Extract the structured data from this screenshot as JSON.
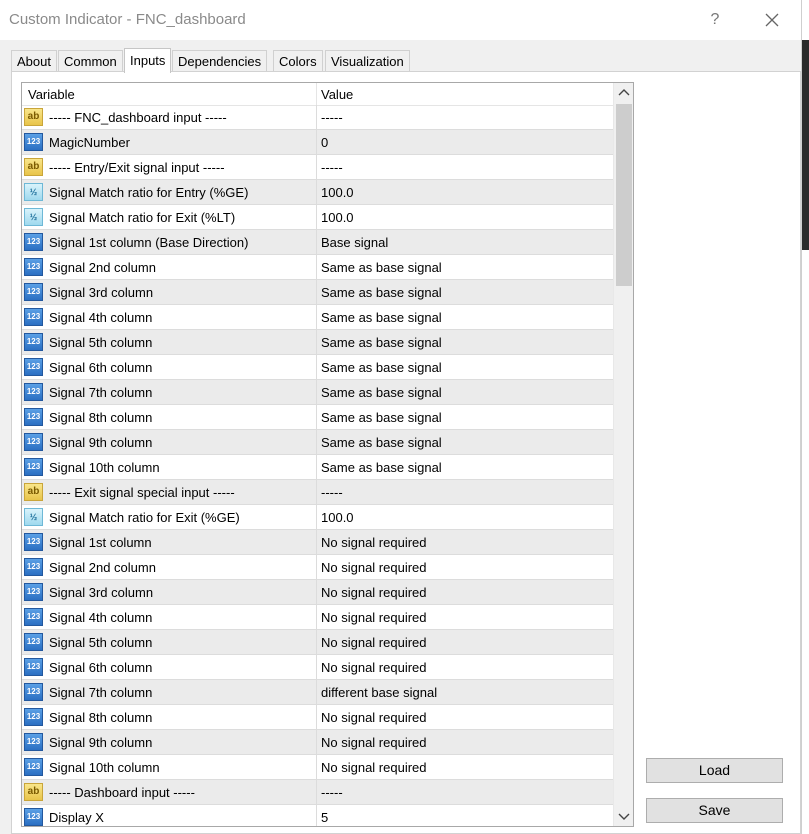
{
  "window": {
    "title": "Custom Indicator - FNC_dashboard",
    "help_label": "?"
  },
  "tabs": [
    {
      "label": "About"
    },
    {
      "label": "Common"
    },
    {
      "label": "Inputs",
      "active": true
    },
    {
      "label": "Dependencies"
    },
    {
      "label": "Colors"
    },
    {
      "label": "Visualization"
    }
  ],
  "grid": {
    "headers": {
      "variable": "Variable",
      "value": "Value"
    },
    "rows": [
      {
        "type": "string",
        "icon": "ab-icon",
        "variable": "----- FNC_dashboard input -----",
        "value": "-----"
      },
      {
        "type": "int",
        "icon": "123-icon",
        "variable": "MagicNumber",
        "value": "0"
      },
      {
        "type": "string",
        "icon": "ab-icon",
        "variable": "----- Entry/Exit signal input -----",
        "value": "-----"
      },
      {
        "type": "double",
        "icon": "half-icon",
        "variable": "Signal Match ratio for Entry (%GE)",
        "value": "100.0"
      },
      {
        "type": "double",
        "icon": "half-icon",
        "variable": "Signal Match ratio for Exit (%LT)",
        "value": "100.0"
      },
      {
        "type": "int",
        "icon": "123-icon",
        "variable": "Signal 1st column (Base Direction)",
        "value": "Base signal"
      },
      {
        "type": "int",
        "icon": "123-icon",
        "variable": "Signal 2nd column",
        "value": "Same as base signal"
      },
      {
        "type": "int",
        "icon": "123-icon",
        "variable": "Signal 3rd column",
        "value": "Same as base signal"
      },
      {
        "type": "int",
        "icon": "123-icon",
        "variable": "Signal 4th column",
        "value": "Same as base signal"
      },
      {
        "type": "int",
        "icon": "123-icon",
        "variable": "Signal 5th column",
        "value": "Same as base signal"
      },
      {
        "type": "int",
        "icon": "123-icon",
        "variable": "Signal 6th column",
        "value": "Same as base signal"
      },
      {
        "type": "int",
        "icon": "123-icon",
        "variable": "Signal 7th column",
        "value": "Same as base signal"
      },
      {
        "type": "int",
        "icon": "123-icon",
        "variable": "Signal 8th column",
        "value": "Same as base signal"
      },
      {
        "type": "int",
        "icon": "123-icon",
        "variable": "Signal 9th column",
        "value": "Same as base signal"
      },
      {
        "type": "int",
        "icon": "123-icon",
        "variable": "Signal 10th column",
        "value": "Same as base signal"
      },
      {
        "type": "string",
        "icon": "ab-icon",
        "variable": "----- Exit signal special input -----",
        "value": "-----"
      },
      {
        "type": "double",
        "icon": "half-icon",
        "variable": "Signal Match ratio for Exit (%GE)",
        "value": "100.0"
      },
      {
        "type": "int",
        "icon": "123-icon",
        "variable": "Signal 1st column",
        "value": "No signal required"
      },
      {
        "type": "int",
        "icon": "123-icon",
        "variable": "Signal 2nd column",
        "value": "No signal required"
      },
      {
        "type": "int",
        "icon": "123-icon",
        "variable": "Signal 3rd column",
        "value": "No signal required"
      },
      {
        "type": "int",
        "icon": "123-icon",
        "variable": "Signal 4th column",
        "value": "No signal required"
      },
      {
        "type": "int",
        "icon": "123-icon",
        "variable": "Signal 5th column",
        "value": "No signal required"
      },
      {
        "type": "int",
        "icon": "123-icon",
        "variable": "Signal 6th column",
        "value": "No signal required"
      },
      {
        "type": "int",
        "icon": "123-icon",
        "variable": "Signal 7th column",
        "value": "different base signal"
      },
      {
        "type": "int",
        "icon": "123-icon",
        "variable": "Signal 8th column",
        "value": "No signal required"
      },
      {
        "type": "int",
        "icon": "123-icon",
        "variable": "Signal 9th column",
        "value": "No signal required"
      },
      {
        "type": "int",
        "icon": "123-icon",
        "variable": "Signal 10th column",
        "value": "No signal required"
      },
      {
        "type": "string",
        "icon": "ab-icon",
        "variable": "----- Dashboard input -----",
        "value": "-----"
      },
      {
        "type": "int",
        "icon": "123-icon",
        "variable": "Display X",
        "value": "5"
      }
    ]
  },
  "buttons": {
    "load_label": "Load",
    "save_label": "Save"
  }
}
